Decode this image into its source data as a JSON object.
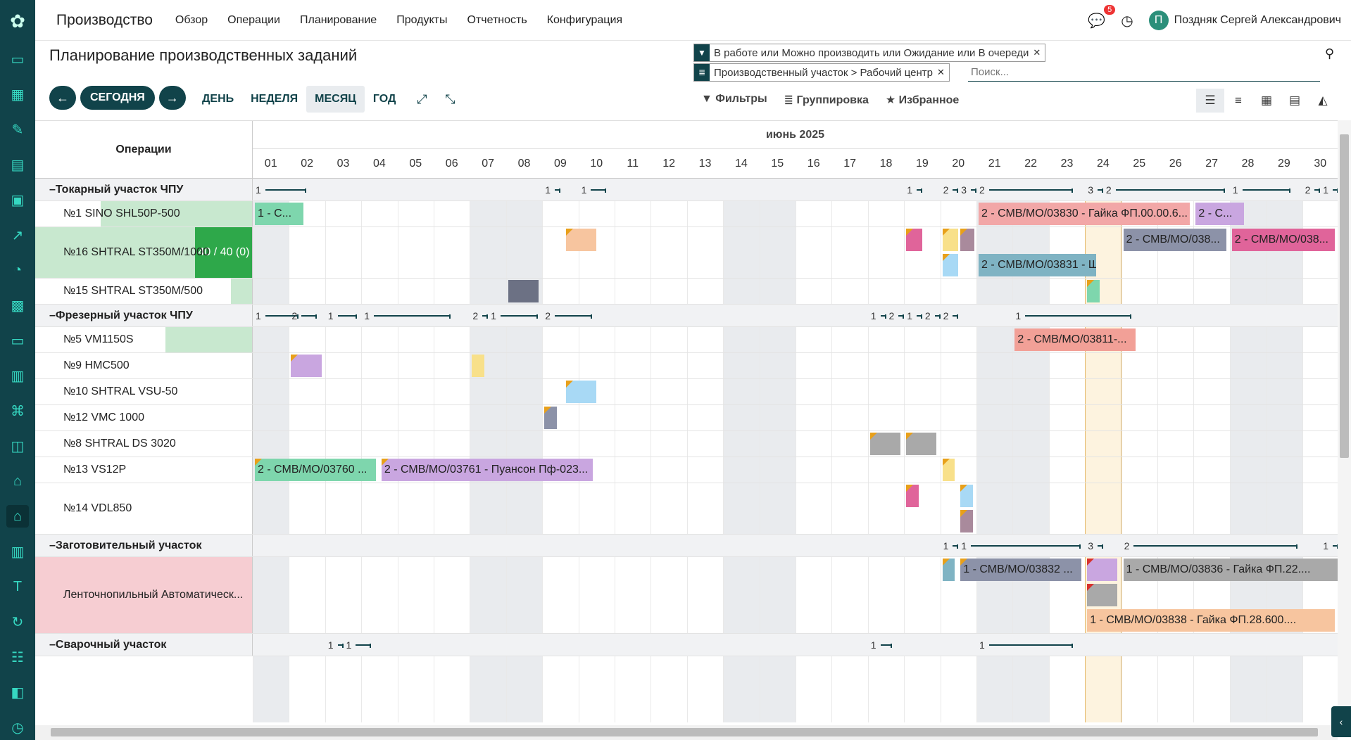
{
  "topbar": {
    "app_name": "Производство",
    "menu": [
      "Обзор",
      "Операции",
      "Планирование",
      "Продукты",
      "Отчетность",
      "Конфигурация"
    ],
    "chat_count": "5",
    "user_initial": "П",
    "user_name": "Поздняк Сергей Александрович"
  },
  "page": {
    "title": "Планирование производственных заданий"
  },
  "search": {
    "facet1": "В работе или Можно производить или Ожидание или В очереди",
    "facet2": "Производственный участок > Рабочий центр",
    "placeholder": "Поиск..."
  },
  "controls": {
    "today": "СЕГОДНЯ",
    "scales": [
      "ДЕНЬ",
      "НЕДЕЛЯ",
      "МЕСЯЦ",
      "ГОД"
    ],
    "active_scale": "МЕСЯЦ",
    "filters": "Фильтры",
    "group_by": "Группировка",
    "favorites": "Избранное"
  },
  "gantt": {
    "ops_title": "Операции",
    "month": "июнь 2025",
    "days": [
      "01",
      "02",
      "03",
      "04",
      "05",
      "06",
      "07",
      "08",
      "09",
      "10",
      "11",
      "12",
      "13",
      "14",
      "15",
      "16",
      "17",
      "18",
      "19",
      "20",
      "21",
      "22",
      "23",
      "24",
      "25",
      "26",
      "27",
      "28",
      "29",
      "30"
    ],
    "weekend_days": [
      1,
      7,
      8,
      14,
      15,
      21,
      22,
      28,
      29
    ],
    "today": 24,
    "rows": [
      {
        "type": "group",
        "label": "Токарный участок ЧПУ",
        "counters": [
          {
            "d": 1,
            "n": "1",
            "len": 1.4
          },
          {
            "d": 9,
            "n": "1",
            "len": 0.1
          },
          {
            "d": 10,
            "n": "1",
            "len": 0.7
          },
          {
            "d": 19,
            "n": "1",
            "len": 0.1
          },
          {
            "d": 20,
            "n": "2",
            "len": 0.1
          },
          {
            "d": 20.5,
            "n": "3",
            "len": 0.1
          },
          {
            "d": 21,
            "n": "2",
            "len": 2.6
          },
          {
            "d": 24,
            "n": "3",
            "len": 0.1
          },
          {
            "d": 24.5,
            "n": "2",
            "len": 3.3
          },
          {
            "d": 28,
            "n": "1",
            "len": 1.6
          },
          {
            "d": 30,
            "n": "2",
            "len": 0.1
          },
          {
            "d": 30.5,
            "n": "1",
            "len": 0.1
          }
        ]
      },
      {
        "type": "res",
        "label": "№1 SINO SHL50P-500",
        "h": 36,
        "load": 0.7,
        "pills": [
          {
            "s": 1,
            "e": 2.4,
            "c": "#7ed6ad",
            "t": "1 - C..."
          },
          {
            "s": 21,
            "e": 26.9,
            "c": "#f2a7a7",
            "t": "2 - СМВ/МО/03830 - Гайка ФП.00.00.6..."
          },
          {
            "s": 27,
            "e": 28.4,
            "c": "#c9a6e0",
            "t": "2 - С..."
          }
        ]
      },
      {
        "type": "res",
        "label": "№16 SHTRAL ST350M/1000",
        "h": 72,
        "loadtxt": "40 / 40 (0)",
        "loadfull": true,
        "pills": [
          {
            "s": 9.6,
            "e": 10.5,
            "c": "#f7c59f",
            "corner": true,
            "y": 0
          },
          {
            "s": 19,
            "e": 19.5,
            "c": "#e0649a",
            "corner": true,
            "y": 0
          },
          {
            "s": 20,
            "e": 20.5,
            "c": "#f8e08a",
            "corner": true,
            "y": 0
          },
          {
            "s": 20.5,
            "e": 20.95,
            "c": "#a98a9c",
            "corner": true,
            "y": 0
          },
          {
            "s": 25,
            "e": 27.9,
            "c": "#8c92a8",
            "t": "2 - СМВ/МО/038...",
            "y": 0
          },
          {
            "s": 28,
            "e": 30.9,
            "c": "#e0649a",
            "t": "2 - СМВ/МО/038...",
            "y": 0
          },
          {
            "s": 20,
            "e": 20.5,
            "c": "#a8d9f5",
            "corner": true,
            "y": 1
          },
          {
            "s": 21,
            "e": 24.3,
            "c": "#7fb3c3",
            "t": "2 - СМВ/МО/03831 - Ш...",
            "y": 1
          },
          {
            "s": 31,
            "e": 31.9,
            "c": "#a9a9a9",
            "y": 1
          }
        ]
      },
      {
        "type": "res",
        "label": "№15 SHTRAL ST350M/500",
        "h": 36,
        "load": 0.1,
        "pills": [
          {
            "s": 8,
            "e": 8.9,
            "c": "#6c7184"
          },
          {
            "s": 24,
            "e": 24.4,
            "c": "#7ed6ad",
            "corner": true
          }
        ]
      },
      {
        "type": "group",
        "label": "Фрезерный участок ЧПУ",
        "counters": [
          {
            "d": 1,
            "n": "1",
            "len": 1.2
          },
          {
            "d": 2,
            "n": "2",
            "len": 0.7
          },
          {
            "d": 3,
            "n": "1",
            "len": 0.8
          },
          {
            "d": 4,
            "n": "1",
            "len": 2.4
          },
          {
            "d": 7,
            "n": "2",
            "len": 0.1
          },
          {
            "d": 7.5,
            "n": "1",
            "len": 1.3
          },
          {
            "d": 9,
            "n": "2",
            "len": 1.3
          },
          {
            "d": 18,
            "n": "1",
            "len": 0.1
          },
          {
            "d": 18.5,
            "n": "2",
            "len": 0.1
          },
          {
            "d": 19,
            "n": "1",
            "len": 0.1
          },
          {
            "d": 19.5,
            "n": "2",
            "len": 0.1
          },
          {
            "d": 20,
            "n": "2",
            "len": 0.1
          },
          {
            "d": 22,
            "n": "1",
            "len": 3.2
          }
        ]
      },
      {
        "type": "res",
        "label": "№5 VM1150S",
        "h": 36,
        "load": 0.4,
        "pills": [
          {
            "s": 22,
            "e": 25.4,
            "c": "#f2a097",
            "t": "2 - СМВ/МО/03811-..."
          }
        ]
      },
      {
        "type": "res",
        "label": "№9 HMC500",
        "h": 36,
        "pills": [
          {
            "s": 2,
            "e": 2.9,
            "c": "#c9a6e0",
            "corner": true
          },
          {
            "s": 7,
            "e": 7.4,
            "c": "#f8e08a"
          }
        ]
      },
      {
        "type": "res",
        "label": "№10 SHTRAL VSU-50",
        "h": 36,
        "pills": [
          {
            "s": 9.6,
            "e": 10.5,
            "c": "#a8d9f5",
            "corner": true
          }
        ]
      },
      {
        "type": "res",
        "label": "№12 VMC 1000",
        "h": 36,
        "pills": [
          {
            "s": 9,
            "e": 9.4,
            "c": "#8c92a8",
            "corner": true
          }
        ]
      },
      {
        "type": "res",
        "label": "№8 SHTRAL DS 3020",
        "h": 36,
        "pills": [
          {
            "s": 18,
            "e": 18.9,
            "c": "#a9a9a9",
            "corner": true
          },
          {
            "s": 19,
            "e": 19.9,
            "c": "#a9a9a9",
            "corner": true
          }
        ]
      },
      {
        "type": "res",
        "label": "№13 VS12P",
        "h": 36,
        "pills": [
          {
            "s": 1,
            "e": 4.4,
            "c": "#7ed6ad",
            "corner": true,
            "t": "2 - СМВ/МО/03760 ..."
          },
          {
            "s": 4.5,
            "e": 10.4,
            "c": "#c9a6e0",
            "corner": true,
            "t": "2 - СМВ/МО/03761 - Пуансон Пф-023..."
          },
          {
            "s": 20,
            "e": 20.4,
            "c": "#f8e08a",
            "corner": true
          }
        ]
      },
      {
        "type": "res",
        "label": "№14 VDL850",
        "h": 72,
        "pills": [
          {
            "s": 19,
            "e": 19.4,
            "c": "#e0649a",
            "corner": true,
            "y": 0
          },
          {
            "s": 20.5,
            "e": 20.9,
            "c": "#a8d9f5",
            "corner": true,
            "y": 0
          },
          {
            "s": 20.5,
            "e": 20.9,
            "c": "#a98a9c",
            "corner": true,
            "y": 1
          }
        ]
      },
      {
        "type": "group",
        "label": "Заготовительный участок",
        "counters": [
          {
            "d": 20,
            "n": "1",
            "len": 0.1
          },
          {
            "d": 20.5,
            "n": "1",
            "len": 3.3
          },
          {
            "d": 24,
            "n": "3",
            "len": 0.1
          },
          {
            "d": 25,
            "n": "2",
            "len": 4.8
          },
          {
            "d": 30.5,
            "n": "1",
            "len": 0.1
          }
        ]
      },
      {
        "type": "res",
        "label": "Ленточнопильный Автоматическ...",
        "h": 108,
        "loadred": true,
        "pills": [
          {
            "s": 20,
            "e": 20.4,
            "c": "#7fb3c3",
            "corner": true,
            "y": 0
          },
          {
            "s": 20.5,
            "e": 23.9,
            "c": "#8c92a8",
            "corner": true,
            "t": "1 - СМВ/МО/03832 ...",
            "y": 0
          },
          {
            "s": 24,
            "e": 24.9,
            "c": "#c9a6e0",
            "corner": true,
            "cornerRed": true,
            "y": 0
          },
          {
            "s": 25,
            "e": 31,
            "c": "#a9a9a9",
            "t": "1 - СМВ/МО/03836 - Гайка ФП.22....",
            "y": 0
          },
          {
            "s": 24,
            "e": 24.9,
            "c": "#a9a9a9",
            "corner": true,
            "cornerRed": true,
            "y": 1
          },
          {
            "s": 24,
            "e": 30.9,
            "c": "#f7c59f",
            "t": "1 - СМВ/МО/03838 - Гайка ФП.28.600....",
            "y": 2
          }
        ]
      },
      {
        "type": "group",
        "label": "Сварочный участок",
        "counters": [
          {
            "d": 3,
            "n": "1",
            "len": 0.1
          },
          {
            "d": 3.5,
            "n": "1",
            "len": 0.7
          },
          {
            "d": 18,
            "n": "1",
            "len": 0.6
          },
          {
            "d": 21,
            "n": "1",
            "len": 2.6
          }
        ]
      }
    ]
  }
}
